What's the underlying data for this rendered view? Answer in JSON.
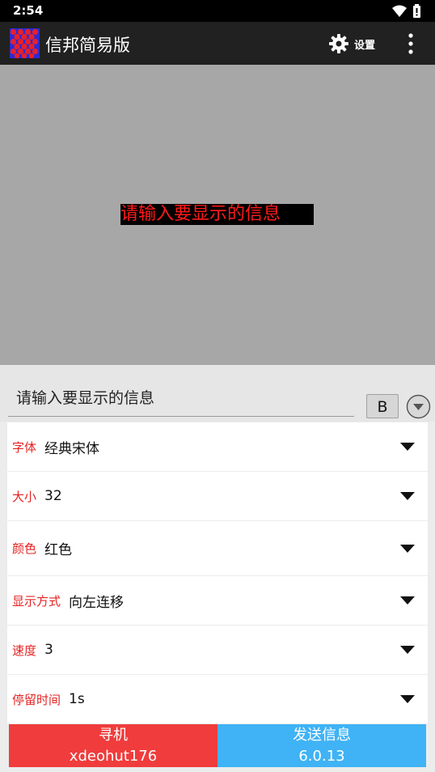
{
  "status_bar": {
    "time": "2:54",
    "icons": [
      "wifi-icon",
      "battery-icon"
    ]
  },
  "app_bar": {
    "title": "信邦简易版",
    "settings_label": "设置",
    "icons": [
      "app-logo-icon",
      "gear-icon",
      "more-vert-icon"
    ]
  },
  "preview": {
    "text": "请输入要显示的信息",
    "text_color": "#ff1a1a",
    "background": "#000000",
    "stage_color": "#a7a7a7"
  },
  "message": {
    "placeholder": "请输入要显示的信息",
    "bold_label": "B"
  },
  "settings": [
    {
      "label": "字体",
      "value": "经典宋体"
    },
    {
      "label": "大小",
      "value": "32"
    },
    {
      "label": "颜色",
      "value": "红色"
    },
    {
      "label": "显示方式",
      "value": "向左连移"
    },
    {
      "label": "速度",
      "value": "3"
    },
    {
      "label": "停留时间",
      "value": "1s"
    }
  ],
  "bottom": {
    "find": {
      "label": "寻机",
      "sub": "xdeohut176",
      "color": "#f03c3c"
    },
    "send": {
      "label": "发送信息",
      "sub": "6.0.13",
      "color": "#3fb3f5"
    }
  },
  "colors": {
    "label_accent": "#e52222",
    "app_bar": "#212121"
  }
}
